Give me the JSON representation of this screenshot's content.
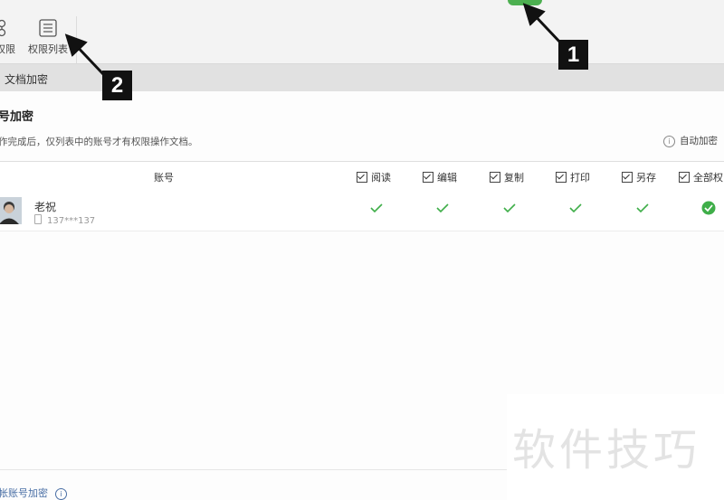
{
  "toolbar": {
    "buttons": [
      {
        "label": "权限",
        "icon": "permission-icon"
      },
      {
        "label": "权限列表",
        "icon": "permission-list-icon"
      }
    ]
  },
  "tab": {
    "label": "文档加密"
  },
  "section": {
    "title": "号加密",
    "description": "作完成后，仅列表中的账号才有权限操作文档。",
    "auto_encrypt": "自动加密"
  },
  "table": {
    "account_header": "账号",
    "columns": [
      "阅读",
      "编辑",
      "复制",
      "打印",
      "另存",
      "全部权"
    ],
    "rows": [
      {
        "name": "老祝",
        "phone": "137***137",
        "permissions": [
          true,
          true,
          true,
          true,
          true,
          true
        ]
      }
    ]
  },
  "footer": {
    "link": "帐账号加密"
  },
  "annotations": {
    "callout_1": "1",
    "callout_2": "2"
  },
  "watermark": "软件技巧",
  "colors": {
    "accent_green": "#4caf50",
    "check_green": "#3fae49"
  }
}
